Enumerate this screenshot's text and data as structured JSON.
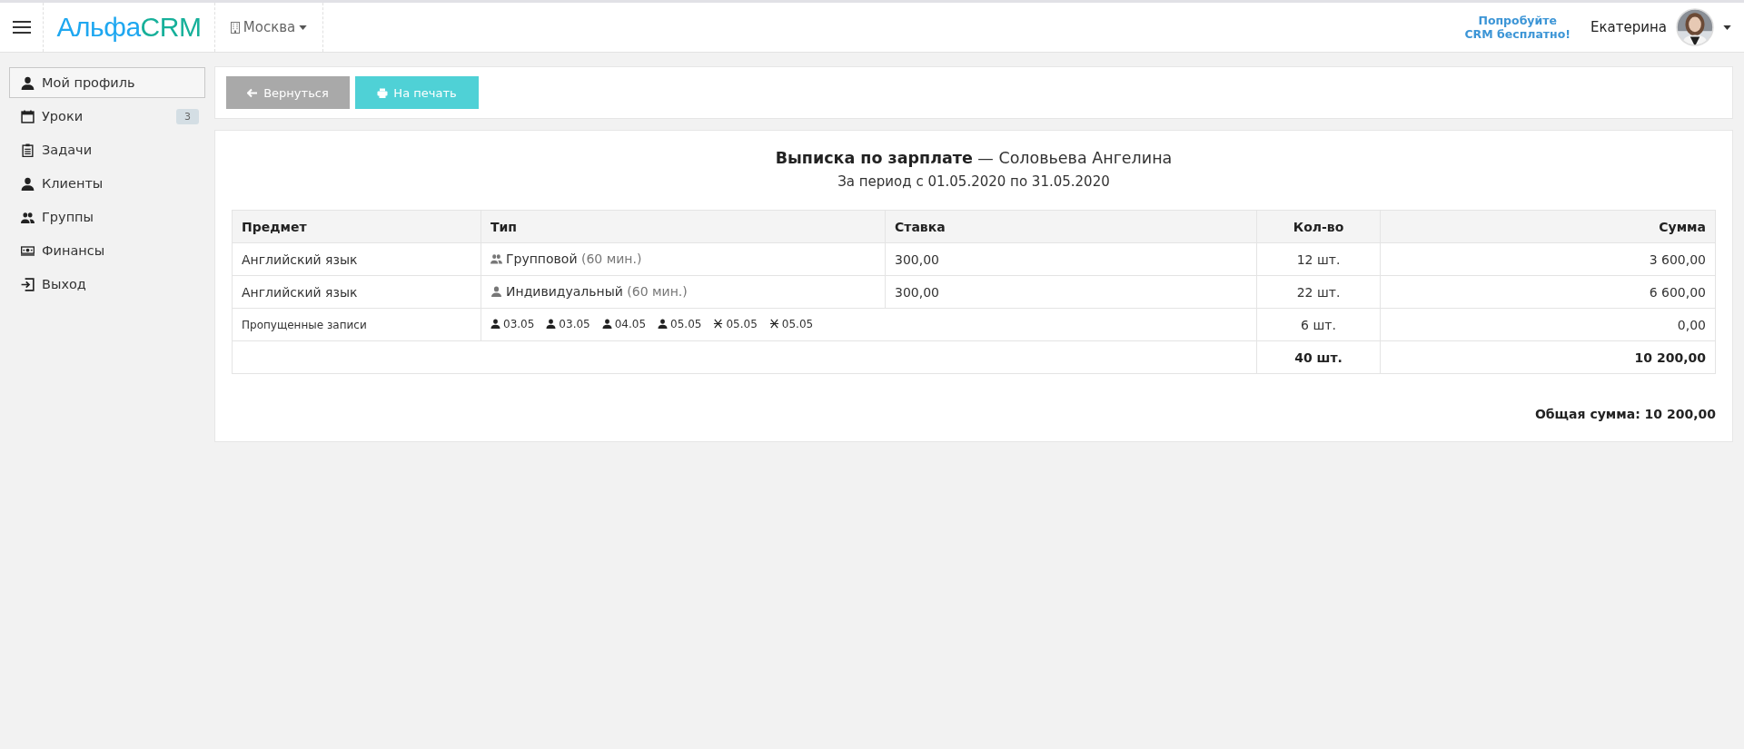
{
  "topbar": {
    "logo": {
      "part1": "Альфа",
      "part2": "CRM"
    },
    "branch": "Москва",
    "promo": [
      "Попробуйте",
      "CRM бесплатно!"
    ],
    "user": "Екатерина"
  },
  "sidebar": {
    "items": [
      {
        "label": "Мой профиль",
        "kind": "person",
        "selected": true
      },
      {
        "label": "Уроки",
        "kind": "calendar",
        "selected": false,
        "badge": "3"
      },
      {
        "label": "Задачи",
        "kind": "clipboard",
        "selected": false
      },
      {
        "label": "Клиенты",
        "kind": "person",
        "selected": false
      },
      {
        "label": "Группы",
        "kind": "group",
        "selected": false
      },
      {
        "label": "Финансы",
        "kind": "money",
        "selected": false
      },
      {
        "label": "Выход",
        "kind": "exit",
        "selected": false
      }
    ]
  },
  "toolbar": {
    "buttons": [
      {
        "label": "Вернуться",
        "kind": "back",
        "disabled": true
      },
      {
        "label": "На печать",
        "kind": "print",
        "disabled": false
      }
    ]
  },
  "report": {
    "title_bold": "Выписка по зарплате",
    "title_rest": "— Соловьева Ангелина",
    "period": "За период с 01.05.2020 по 31.05.2020",
    "table": {
      "columns": [
        "Предмет",
        "Тип",
        "Ставка",
        "Кол-во",
        "Сумма"
      ],
      "rows": [
        {
          "kind": "lesson",
          "subject": "Английский язык",
          "type": {
            "kind": "group",
            "label": "Групповой",
            "duration": "(60 мин.)"
          },
          "rate": "300,00",
          "qty": "12 шт.",
          "sum": "3 600,00"
        },
        {
          "kind": "lesson",
          "subject": "Английский язык",
          "type": {
            "kind": "person",
            "label": "Индивидуальный",
            "duration": "(60 мин.)"
          },
          "rate": "300,00",
          "qty": "22 шт.",
          "sum": "6 600,00"
        },
        {
          "kind": "missed",
          "subject": "Пропущенные записи",
          "entries": [
            {
              "kind": "person",
              "date": "03.05"
            },
            {
              "kind": "person",
              "date": "03.05"
            },
            {
              "kind": "person",
              "date": "04.05"
            },
            {
              "kind": "person",
              "date": "05.05"
            },
            {
              "kind": "cross",
              "date": "05.05"
            },
            {
              "kind": "cross",
              "date": "05.05"
            }
          ],
          "qty": "6 шт.",
          "sum": "0,00"
        },
        {
          "kind": "total",
          "qty": "40 шт.",
          "sum": "10 200,00"
        }
      ]
    },
    "grand_total": "Общая сумма: 10 200,00"
  }
}
